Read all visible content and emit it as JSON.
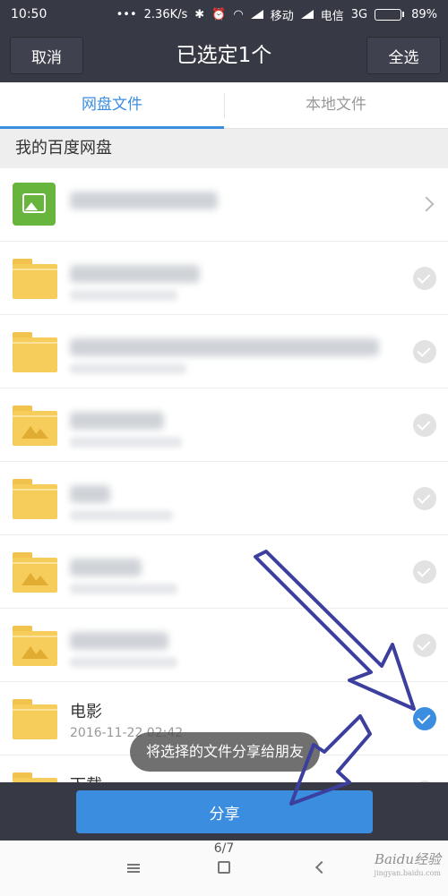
{
  "status_bar": {
    "time": "10:50",
    "network_speed": "2.36K/s",
    "carrier1": "移动",
    "carrier2": "电信",
    "network_type": "3G",
    "battery": "89%",
    "battery_level": 0.89
  },
  "header": {
    "cancel_label": "取消",
    "title": "已选定1个",
    "select_all_label": "全选"
  },
  "tabs": [
    {
      "label": "网盘文件",
      "active": true
    },
    {
      "label": "本地文件",
      "active": false
    }
  ],
  "section_title": "我的百度网盘",
  "files": [
    {
      "type": "image-folder",
      "name": "",
      "date": "",
      "action": "chevron"
    },
    {
      "type": "folder",
      "name": "",
      "date": "",
      "action": "check",
      "checked": false
    },
    {
      "type": "folder",
      "name": "",
      "date": "",
      "action": "check",
      "checked": false
    },
    {
      "type": "photo-folder",
      "name": "",
      "date": "",
      "action": "check",
      "checked": false
    },
    {
      "type": "folder",
      "name": "",
      "date": "",
      "action": "check",
      "checked": false
    },
    {
      "type": "photo-folder",
      "name": "",
      "date": "",
      "action": "check",
      "checked": false
    },
    {
      "type": "photo-folder",
      "name": "",
      "date": "",
      "action": "check",
      "checked": false
    },
    {
      "type": "folder",
      "name": "电影",
      "date": "2016-11-22 02:42",
      "action": "check",
      "checked": true
    },
    {
      "type": "folder",
      "name": "下载",
      "date": "",
      "action": "check",
      "checked": false
    }
  ],
  "toast": "将选择的文件分享给朋友",
  "share_label": "分享",
  "page_indicator": "6/7",
  "watermark": {
    "brand": "Baidu经验",
    "url": "jingyan.baidu.com"
  },
  "colors": {
    "accent": "#3b8de0",
    "bar": "#373a45"
  }
}
